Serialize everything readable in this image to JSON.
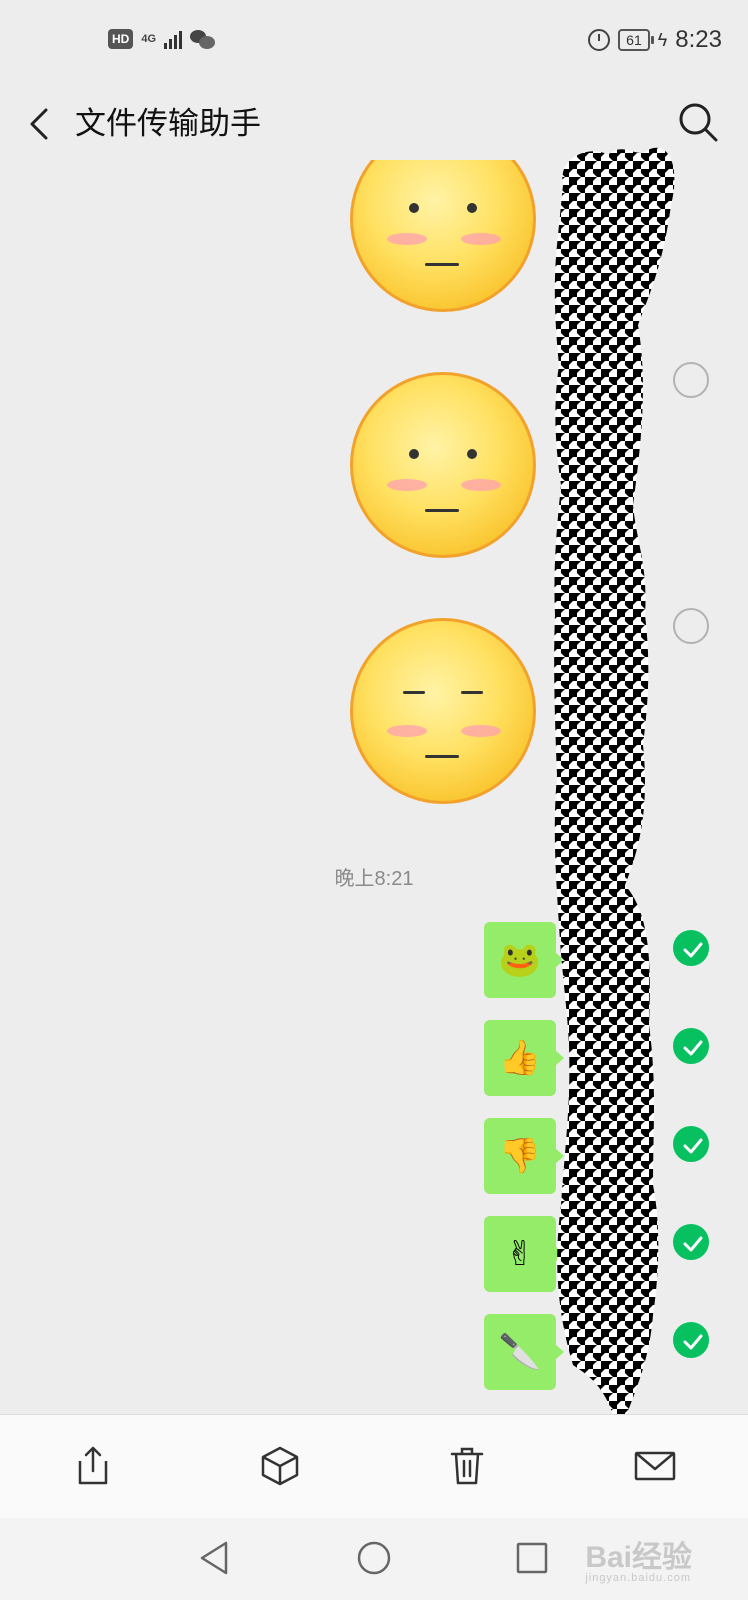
{
  "status_bar": {
    "hd": "HD",
    "network": "4G",
    "battery": "61",
    "time": "8:23",
    "icons": [
      "wechat-icon",
      "alarm-icon",
      "charging-icon"
    ]
  },
  "header": {
    "title": "文件传输助手",
    "back_icon": "chevron-left-icon",
    "search_icon": "search-icon"
  },
  "messages": {
    "stickers": [
      {
        "expression": "neutral-open-eyes",
        "selected": false
      },
      {
        "expression": "neutral-open-eyes",
        "selected": false
      },
      {
        "expression": "neutral-closed-eyes",
        "selected": false
      }
    ],
    "timestamp": "晚上8:21",
    "emoji_messages": [
      {
        "emoji": "🐸",
        "icon": "frog-icon",
        "selected": true
      },
      {
        "emoji": "👍",
        "icon": "thumbs-up-icon",
        "selected": true
      },
      {
        "emoji": "👎",
        "icon": "thumbs-down-icon",
        "selected": true
      },
      {
        "emoji": "✌",
        "icon": "victory-hand-icon",
        "selected": true
      },
      {
        "emoji": "🔪",
        "icon": "knife-icon",
        "selected": true
      }
    ]
  },
  "action_bar": {
    "items": [
      "share-icon",
      "favorite-box-icon",
      "delete-icon",
      "mail-icon"
    ]
  },
  "nav_bar": {
    "items": [
      "back-triangle-icon",
      "home-circle-icon",
      "recents-square-icon"
    ]
  },
  "watermark": {
    "text": "Bai经验",
    "subtext": "jingyan.baidu.com"
  },
  "colors": {
    "background": "#ededed",
    "bubble_green": "#95ec69",
    "selected_green": "#07c160",
    "sticker_yellow": "#ffe060"
  }
}
